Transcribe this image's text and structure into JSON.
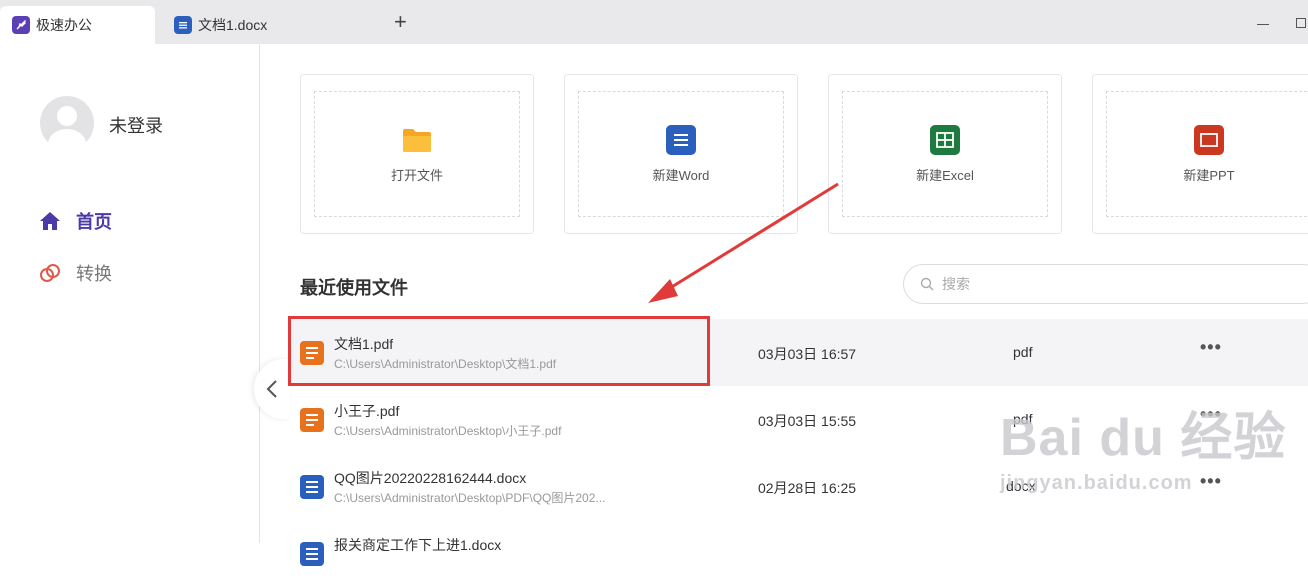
{
  "tabs": [
    {
      "label": "极速办公",
      "active": true
    },
    {
      "label": "文档1.docx",
      "active": false
    }
  ],
  "user": {
    "name": "未登录"
  },
  "nav": [
    {
      "label": "首页",
      "active": true
    },
    {
      "label": "转换",
      "active": false
    }
  ],
  "cards": [
    {
      "label": "打开文件",
      "icon": "folder-icon",
      "color": "#f5a623"
    },
    {
      "label": "新建Word",
      "icon": "word-icon",
      "color": "#2b5fbd"
    },
    {
      "label": "新建Excel",
      "icon": "excel-icon",
      "color": "#1f7a3f"
    },
    {
      "label": "新建PPT",
      "icon": "ppt-icon",
      "color": "#c9381f"
    }
  ],
  "recent": {
    "title": "最近使用文件",
    "search_placeholder": "搜索",
    "files": [
      {
        "name": "文档1.pdf",
        "path": "C:\\Users\\Administrator\\Desktop\\文档1.pdf",
        "date": "03月03日 16:57",
        "type": "pdf",
        "more": "•••",
        "icon_color": "#e8711d"
      },
      {
        "name": "小王子.pdf",
        "path": "C:\\Users\\Administrator\\Desktop\\小王子.pdf",
        "date": "03月03日 15:55",
        "type": "pdf",
        "more": "•••",
        "icon_color": "#e8711d"
      },
      {
        "name": "QQ图片20220228162444.docx",
        "path": "C:\\Users\\Administrator\\Desktop\\PDF\\QQ图片202...",
        "date": "02月28日 16:25",
        "type": "docx",
        "more": "•••",
        "icon_color": "#2b5fbd"
      },
      {
        "name": "报关商定工作下上进1.docx",
        "path": "",
        "date": "",
        "type": "",
        "more": "",
        "icon_color": "#2b5fbd"
      }
    ]
  },
  "watermark": {
    "main": "Bai du 经验",
    "sub": "jingyan.baidu.com"
  },
  "colors": {
    "accent": "#4a3aa7",
    "highlight": "#e03a3a"
  }
}
